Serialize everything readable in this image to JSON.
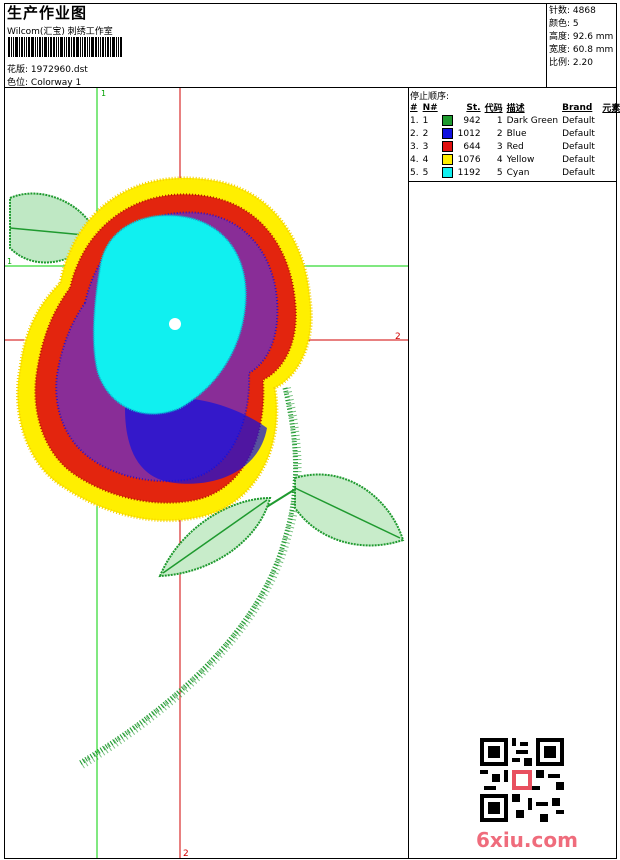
{
  "header": {
    "title": "生产作业图",
    "subtitle": "Wilcom(汇宝) 刺绣工作室",
    "design_label": "花版:",
    "design_value": "1972960.dst",
    "colorway_label": "色位:",
    "colorway_value": "Colorway 1"
  },
  "stats": {
    "stitches": "针数: 4868",
    "colors": "颜色: 5",
    "height": "高度: 92.6 mm",
    "width": "宽度: 60.8 mm",
    "scale": "比例: 2.20"
  },
  "stop_sequence": {
    "title": "停止顺序:",
    "headers": [
      "#",
      "N#",
      "St.",
      "代码",
      "描述",
      "Brand",
      "元素"
    ],
    "rows": [
      {
        "idx": "1.",
        "n": "1",
        "color": "#1f9a2f",
        "st": "942",
        "code": "1",
        "desc": "Dark Green",
        "brand": "Default"
      },
      {
        "idx": "2.",
        "n": "2",
        "color": "#1010e0",
        "st": "1012",
        "code": "2",
        "desc": "Blue",
        "brand": "Default"
      },
      {
        "idx": "3.",
        "n": "3",
        "color": "#e01010",
        "st": "644",
        "code": "3",
        "desc": "Red",
        "brand": "Default"
      },
      {
        "idx": "4.",
        "n": "4",
        "color": "#ffef00",
        "st": "1076",
        "code": "4",
        "desc": "Yellow",
        "brand": "Default"
      },
      {
        "idx": "5.",
        "n": "5",
        "color": "#10f0f0",
        "st": "1192",
        "code": "5",
        "desc": "Cyan",
        "brand": "Default"
      }
    ]
  },
  "guides": {
    "green_vertical_label": "1",
    "green_horizontal_label": "1",
    "red_horizontal_label": "2",
    "red_vertical_label": "2"
  },
  "colors": {
    "green_guide": "#00d000",
    "red_guide": "#d00000",
    "dark_green": "#1f9a2f",
    "blue": "#1010e0",
    "red": "#e01010",
    "yellow": "#ffef00",
    "cyan": "#10f0f0"
  },
  "watermark": "6xiu.com"
}
